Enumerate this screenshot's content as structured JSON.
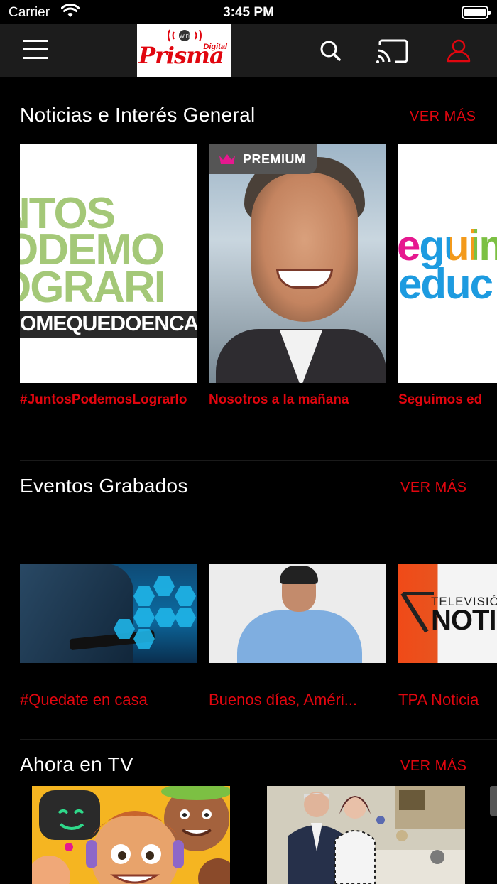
{
  "status_bar": {
    "carrier": "Carrier",
    "time": "3:45 PM"
  },
  "header": {
    "logo_text": "Prisma",
    "logo_sub": "Digital"
  },
  "sections": [
    {
      "title": "Noticias e Interés General",
      "more_label": "VER MÁS",
      "cards": [
        {
          "title": "#JuntosPodemosLograrlo",
          "thumb_lines": [
            "NTOS",
            "ODEMO",
            "OGRARI"
          ],
          "thumb_band": "OMEQUEDOENCA"
        },
        {
          "title": "Nosotros a la mañana",
          "badge": "PREMIUM"
        },
        {
          "title": "Seguimos ed",
          "thumb_lines": [
            "eguim",
            "educ"
          ]
        }
      ]
    },
    {
      "title": "Eventos Grabados",
      "more_label": "VER MÁS",
      "cards": [
        {
          "title": "#Quedate en casa"
        },
        {
          "title": "Buenos días, Améri..."
        },
        {
          "title": "TPA Noticia",
          "thumb_lines": [
            "TELEVISIÓ",
            "NOTI"
          ]
        }
      ]
    },
    {
      "title": "Ahora en TV",
      "more_label": "VER MÁS"
    }
  ],
  "colors": {
    "accent": "#e1060f",
    "background": "#000000",
    "header": "#1c1c1c"
  },
  "icons": [
    "wifi-icon",
    "battery-icon",
    "hamburger-menu-icon",
    "search-icon",
    "cast-icon",
    "user-icon",
    "crown-icon"
  ]
}
